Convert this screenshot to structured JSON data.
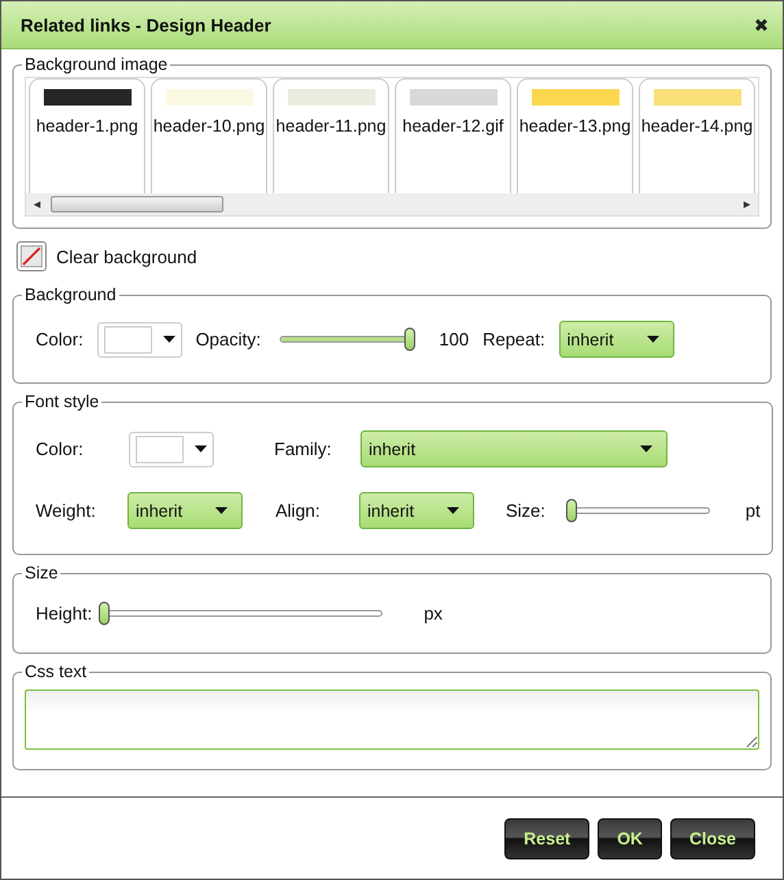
{
  "window": {
    "title": "Related links - Design Header",
    "close": "✖"
  },
  "background_image": {
    "legend": "Background image",
    "thumbnails": [
      {
        "label": "header-1.png",
        "color": "#262626"
      },
      {
        "label": "header-10.png",
        "color": "#fbf8e3"
      },
      {
        "label": "header-11.png",
        "color": "#ecebdf"
      },
      {
        "label": "header-12.gif",
        "color": "#d8d8d8"
      },
      {
        "label": "header-13.png",
        "color": "#fbd74f"
      },
      {
        "label": "header-14.png",
        "color": "#fbe07a"
      }
    ],
    "scroll_left": "◂",
    "scroll_right": "▸",
    "clear_label": "Clear background"
  },
  "background": {
    "legend": "Background",
    "color_label": "Color:",
    "opacity_label": "Opacity:",
    "opacity": {
      "level": 1
    },
    "opacity_reading": "100",
    "repeat_label": "Repeat:",
    "repeat_value": "inherit"
  },
  "font_style": {
    "legend": "Font style",
    "color_label": "Color:",
    "family_label": "Family:",
    "family_value": "inherit",
    "weight_label": "Weight:",
    "weight_value": "inherit",
    "align_label": "Align:",
    "align_value": "inherit",
    "size_label": "Size:",
    "size": {
      "level": 0
    },
    "size_unit": "pt"
  },
  "size": {
    "legend": "Size",
    "height_label": "Height:",
    "height": {
      "level": 0
    },
    "height_unit": "px"
  },
  "css_text": {
    "legend": "Css text"
  },
  "buttons": [
    "Reset",
    "OK",
    "Close"
  ]
}
